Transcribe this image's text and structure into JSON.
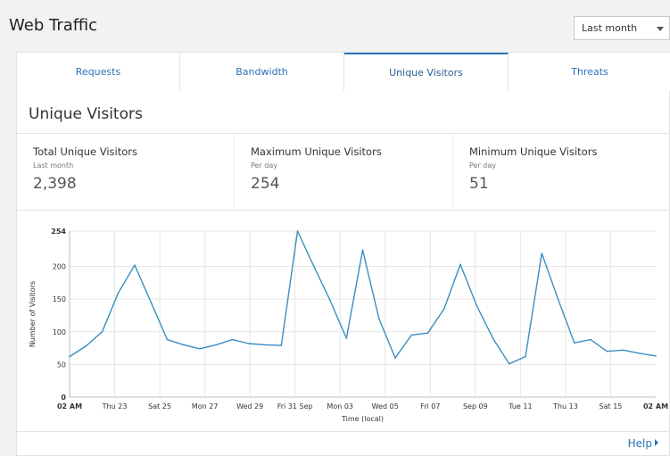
{
  "header": {
    "title": "Web Traffic"
  },
  "range": {
    "selected": "Last month"
  },
  "tabs": [
    {
      "label": "Requests"
    },
    {
      "label": "Bandwidth"
    },
    {
      "label": "Unique Visitors"
    },
    {
      "label": "Threats"
    }
  ],
  "active_tab": 2,
  "section_title": "Unique Visitors",
  "stats": [
    {
      "label": "Total Unique Visitors",
      "sub": "Last month",
      "value": "2,398"
    },
    {
      "label": "Maximum Unique Visitors",
      "sub": "Per day",
      "value": "254"
    },
    {
      "label": "Minimum Unique Visitors",
      "sub": "Per day",
      "value": "51"
    }
  ],
  "footer": {
    "help_label": "Help"
  },
  "chart_data": {
    "type": "line",
    "title": "",
    "xlabel": "Time (local)",
    "ylabel": "Number of Visitors",
    "ylim": [
      0,
      254
    ],
    "yticks": [
      0,
      50,
      100,
      150,
      200,
      254
    ],
    "grid": true,
    "color": "#3b8ec2",
    "xtick_labels": [
      "02 AM",
      "Thu 23",
      "Sat 25",
      "Mon 27",
      "Wed 29",
      "Fri 31 Sep",
      "Mon 03",
      "Wed 05",
      "Fri 07",
      "Sep 09",
      "Tue 11",
      "Thu 13",
      "Sat 15",
      "02 AM"
    ],
    "series": [
      {
        "values": [
          62,
          78,
          100,
          160,
          202,
          145,
          88,
          80,
          74,
          80,
          88,
          82,
          80,
          79,
          254,
          200,
          148,
          90,
          225,
          120,
          60,
          95,
          98,
          135,
          203,
          140,
          90,
          51,
          62,
          220,
          150,
          83,
          88,
          70,
          72,
          67,
          63
        ]
      }
    ]
  }
}
